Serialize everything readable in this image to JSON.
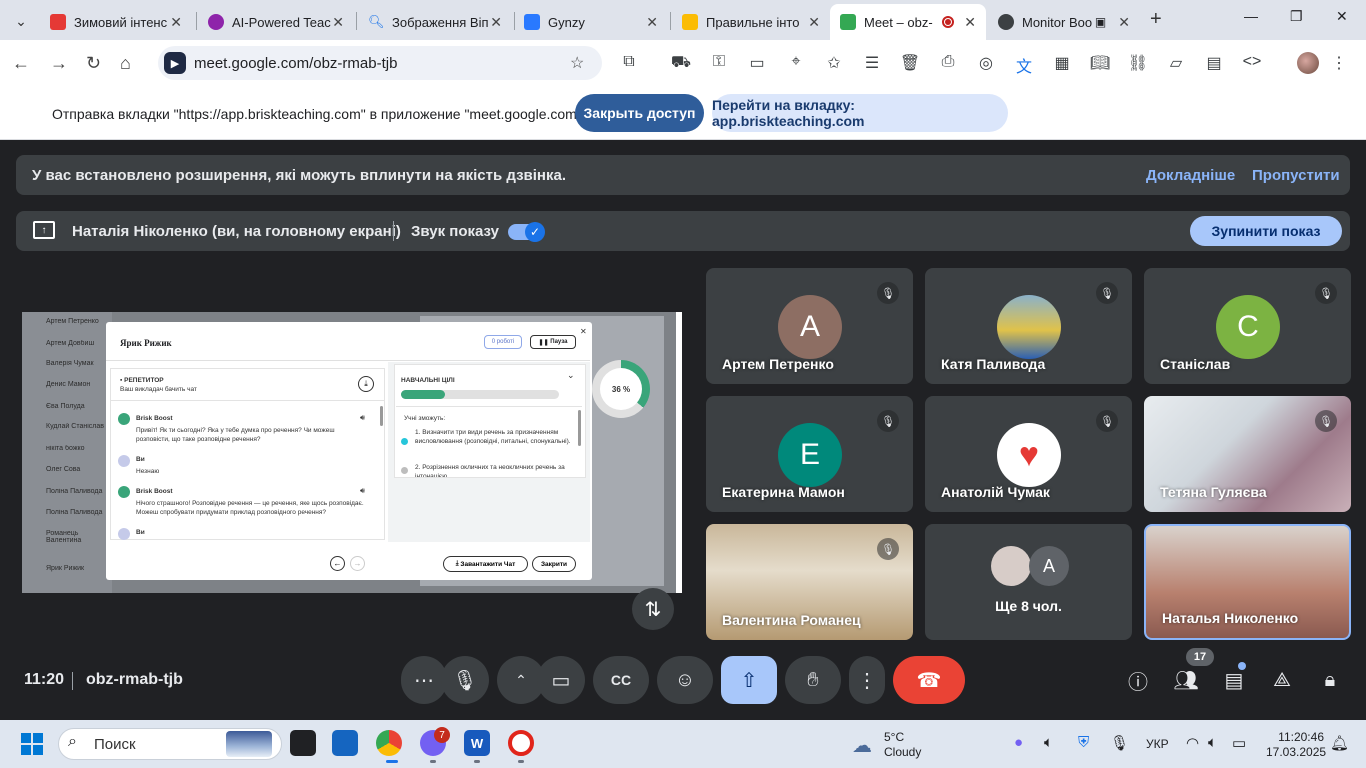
{
  "browser": {
    "tabs": [
      {
        "title": "Зимовий інтенс",
        "color": "#e53935"
      },
      {
        "title": "AI-Powered Teac",
        "color": "#8e24aa"
      },
      {
        "title": "Зображення Віп",
        "color": "#1a73e8"
      },
      {
        "title": "Gynzy",
        "color": "#2979ff"
      },
      {
        "title": "Правильне інто",
        "color": "#fbbc04"
      },
      {
        "title": "Meet – obz-",
        "color": "#34a853"
      },
      {
        "title": "Monitor Boo",
        "color": "#3c4043"
      }
    ],
    "url": "meet.google.com/obz-rmab-tjb",
    "infobar_text": "Отправка вкладки \"https://app.briskteaching.com\" в приложение \"meet.google.com\"...",
    "btn_close_access": "Закрыть доступ",
    "btn_goto": "Перейти на вкладку: app.briskteaching.com"
  },
  "meet": {
    "banner_text": "У вас встановлено розширення, які можуть вплинути на якість дзвінка.",
    "banner_more": "Докладніше",
    "banner_skip": "Пропустити",
    "presenting_text": "Наталія Ніколенко (ви, на головному екрані)",
    "sound_label": "Звук показу",
    "stop_btn": "Зупинити показ",
    "clock": "11:20",
    "meeting_code": "obz-rmab-tjb",
    "participants_count": "17",
    "tiles": [
      {
        "name": "Артем Петренко",
        "initial": "А",
        "color": "#8d6e63"
      },
      {
        "name": "Катя Паливода",
        "initial": "",
        "color": "#c8a46e"
      },
      {
        "name": "Станіслав",
        "initial": "С",
        "color": "#7cb342"
      },
      {
        "name": "Екатерина Мамон",
        "initial": "Е",
        "color": "#00897b"
      },
      {
        "name": "Анатолій Чумак",
        "initial": "",
        "color": "#ffffff"
      },
      {
        "name": "Тетяна Гуляєва",
        "initial": "",
        "color": "#9e7b8b"
      },
      {
        "name": "Валентина Романец",
        "initial": "",
        "color": "#b59a72"
      },
      {
        "name": "Ще 8 чол.",
        "initial": "А",
        "color": "#5f6368"
      },
      {
        "name": "Наталья Николенко",
        "initial": "",
        "color": "#b8806e"
      }
    ]
  },
  "shared": {
    "students": [
      "Артем Петренко",
      "Артем Довбиш",
      "Валерія Чумак",
      "Денис Мамон",
      "Єва Полуда",
      "Кудлай Станіслав",
      "нікіта божко",
      "Олег Сова",
      "Поліна Паливода",
      "Поліна Паливода",
      "Романець Валентина",
      "Ярик Рижик"
    ],
    "modal_title": "Ярик Рижик",
    "chip_robots": "0 роботі",
    "chip_pause": "Пауза",
    "tutor_label": "РЕПЕТИТОР",
    "tutor_sub": "Ваш викладач бачить чат",
    "boost_name": "Brisk Boost",
    "msg1": "Привіт! Як ти сьогодні? Яка у тебе думка про речення? Чи можеш розповісти, що таке розповідне речення?",
    "you": "Ви",
    "reply1": "Незнаю",
    "msg2": "Нічого страшного! Розповідне речення — це речення, яке щось розповідає. Можеш спробувати придумати приклад розповідного речення?",
    "goals_title": "НАВЧАЛЬНІ ЦІЛІ",
    "goals_progress": 0.28,
    "goals_intro": "Учні зможуть:",
    "goal1": "1. Визначити три види речень за призначенням висловлювання (розповідні, питальні, спонукальні).",
    "goal2": "2. Розрізнення окличних та неокличних речень за інтонацією.",
    "btn_download": "Завантажити Чат",
    "btn_close": "Закрити",
    "ring_percent": "36 %",
    "ring_value": 0.36
  },
  "taskbar": {
    "search": "Поиск",
    "weather_temp": "5°C",
    "weather_desc": "Cloudy",
    "lang": "УКР",
    "time": "11:20:46",
    "date": "17.03.2025",
    "viber_badge": "7"
  }
}
